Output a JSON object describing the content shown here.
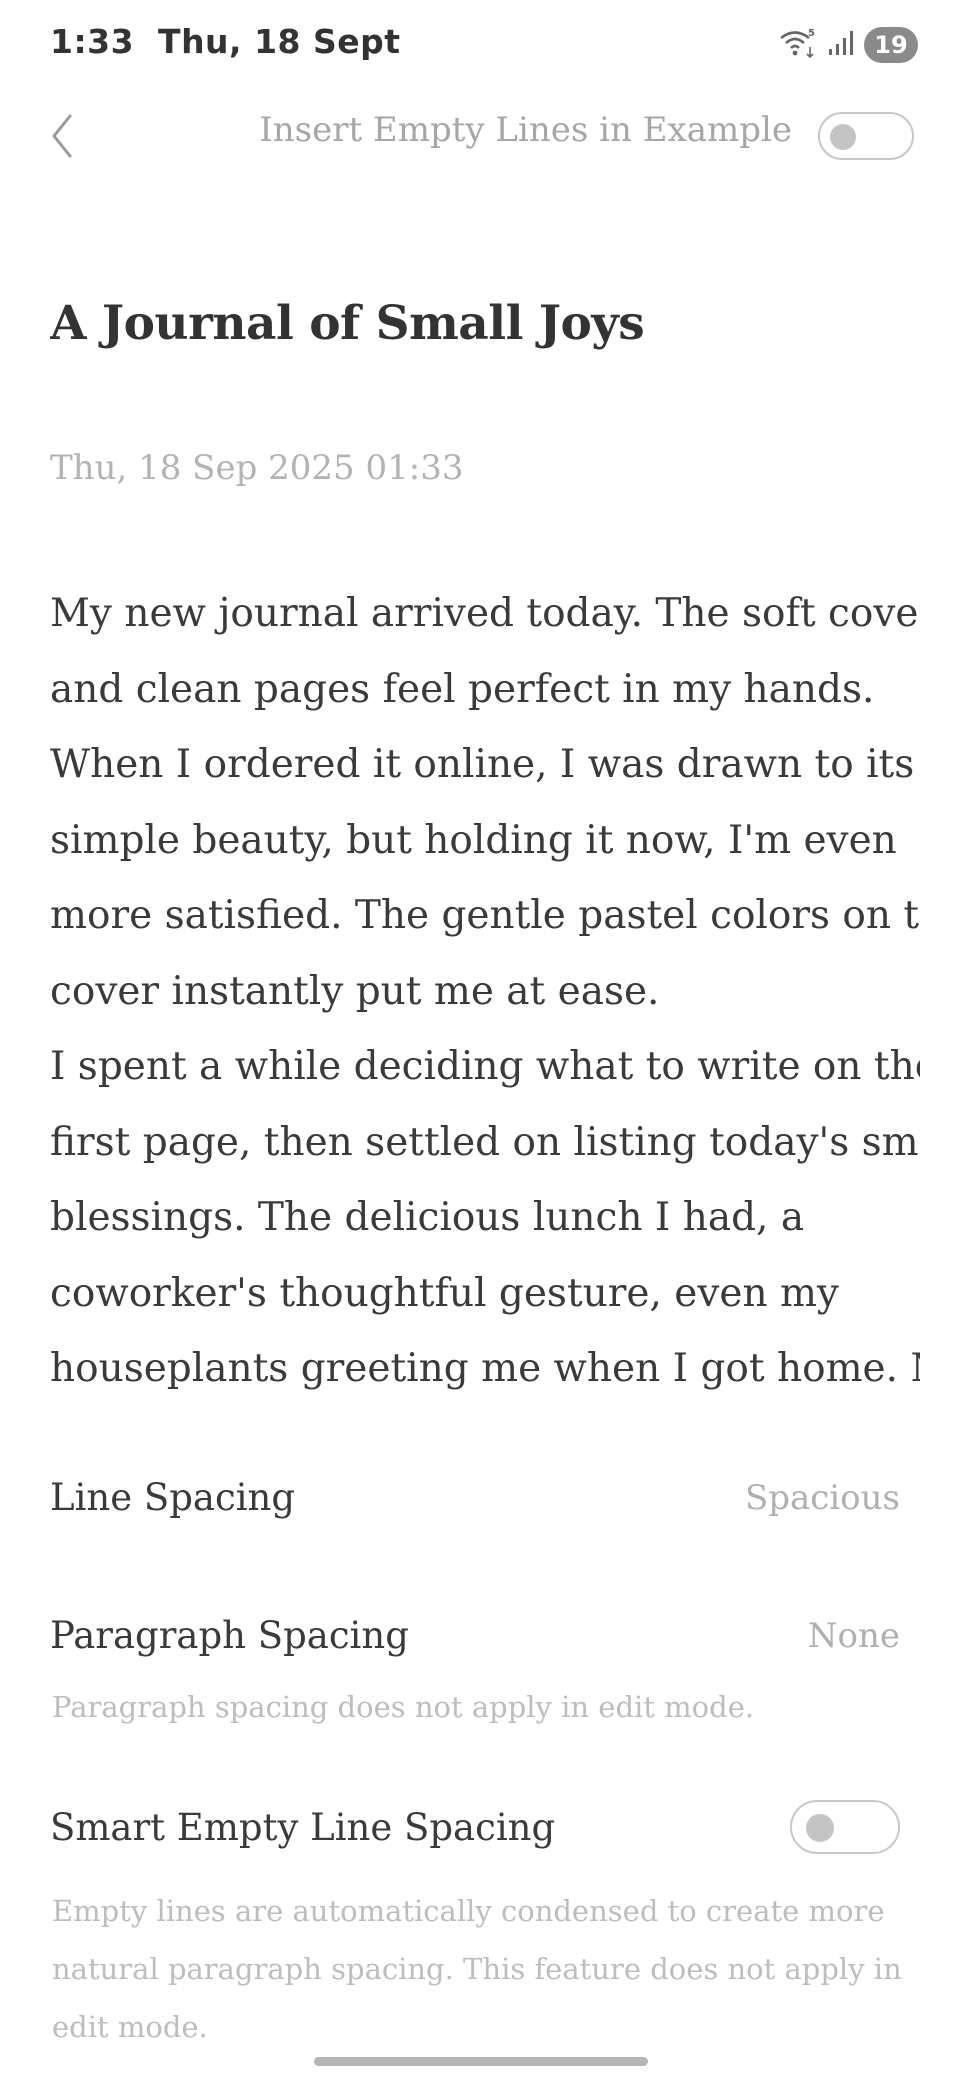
{
  "status_bar": {
    "time_date": "1:33  Thu, 18 Sept",
    "wifi_badge": "5",
    "battery": "19",
    "icons": [
      "wifi-icon",
      "signal-icon",
      "battery-icon"
    ]
  },
  "header": {
    "back_icon": "chevron-left-icon",
    "insert_empty_lines_label": "Insert Empty Lines in Example",
    "insert_empty_lines_on": false
  },
  "preview": {
    "title": "A Journal of Small Joys",
    "date": "Thu, 18 Sep 2025 01:33",
    "body_lines": [
      "My new journal arrived today. The soft cover",
      "and clean pages feel perfect in my hands.",
      "When I ordered it online, I was drawn to its",
      "simple beauty, but holding it now, I'm even",
      "more satisfied. The gentle pastel colors on the",
      "cover instantly put me at ease.",
      "I spent a while deciding what to write on the",
      "first page, then settled on listing today's small",
      "blessings. The delicious lunch I had, a",
      "coworker's thoughtful gesture, even my",
      "houseplants greeting me when I got home. My"
    ]
  },
  "settings": {
    "line_spacing": {
      "label": "Line Spacing",
      "value": "Spacious"
    },
    "paragraph_spacing": {
      "label": "Paragraph Spacing",
      "value": "None",
      "note": "Paragraph spacing does not apply in edit mode."
    },
    "smart_empty_line": {
      "label": "Smart Empty Line Spacing",
      "enabled": false,
      "note_lines": [
        "Empty lines are automatically condensed to create more",
        "natural paragraph spacing. This feature does not apply in",
        "edit mode."
      ]
    }
  },
  "colors": {
    "text": "#333333",
    "muted": "#b3b3b3",
    "toggle_border": "#c8c8c8"
  }
}
